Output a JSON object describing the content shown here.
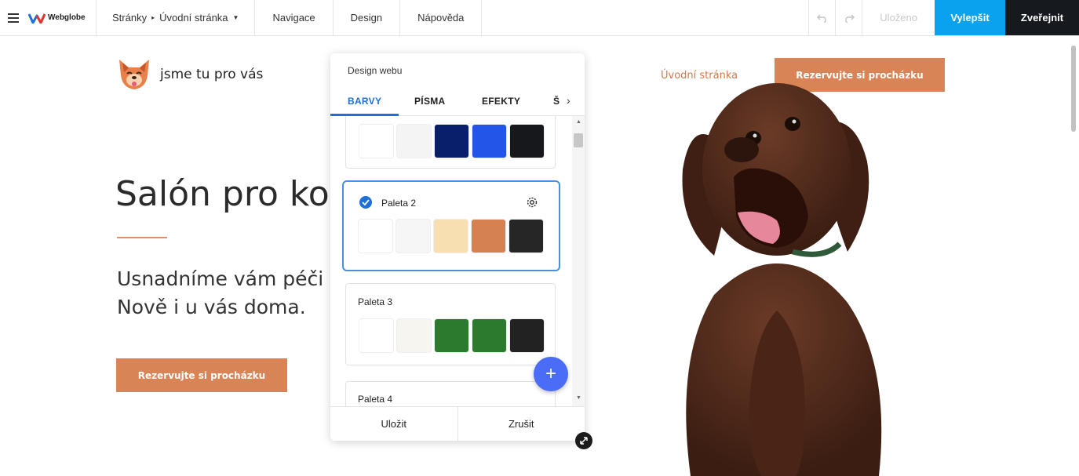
{
  "editor": {
    "logo_text": "Webglobe",
    "pages_label": "Stránky",
    "current_page": "Úvodní stránka",
    "menu": [
      "Navigace",
      "Design",
      "Nápověda"
    ],
    "saved_status": "Uloženo",
    "improve_label": "Vylepšit",
    "publish_label": "Zveřejnit",
    "colors": {
      "improve": "#0aa2ee",
      "publish": "#16191e"
    }
  },
  "site": {
    "brand_text": "jsme tu pro vás",
    "nav_link": "Úvodní stránka",
    "cta_top": "Rezervujte si procházku",
    "hero_title": "Salón pro ko",
    "hero_sub_line1": "Usnadníme vám péči",
    "hero_sub_line2": "Nově i u vás doma.",
    "cta_main": "Rezervujte si procházku",
    "accent_color": "#d88457"
  },
  "panel": {
    "title": "Design webu",
    "tabs": [
      {
        "label": "BARVY",
        "active": true
      },
      {
        "label": "PÍSMA",
        "active": false
      },
      {
        "label": "EFEKTY",
        "active": false
      },
      {
        "label": "Š",
        "active": false
      }
    ],
    "palettes": [
      {
        "name": "",
        "selected": false,
        "colors": [
          "#ffffff",
          "#f4f4f4",
          "#0a1f6b",
          "#2356e8",
          "#16181b"
        ]
      },
      {
        "name": "Paleta 2",
        "selected": true,
        "colors": [
          "#ffffff",
          "#f6f6f6",
          "#f7dfb2",
          "#d58151",
          "#262626"
        ]
      },
      {
        "name": "Paleta 3",
        "selected": false,
        "colors": [
          "#ffffff",
          "#f6f5f0",
          "#2b7a2e",
          "#2b7a2e",
          "#222222"
        ]
      },
      {
        "name": "Paleta 4",
        "selected": false,
        "colors": []
      }
    ],
    "save_label": "Uložit",
    "cancel_label": "Zrušit"
  }
}
